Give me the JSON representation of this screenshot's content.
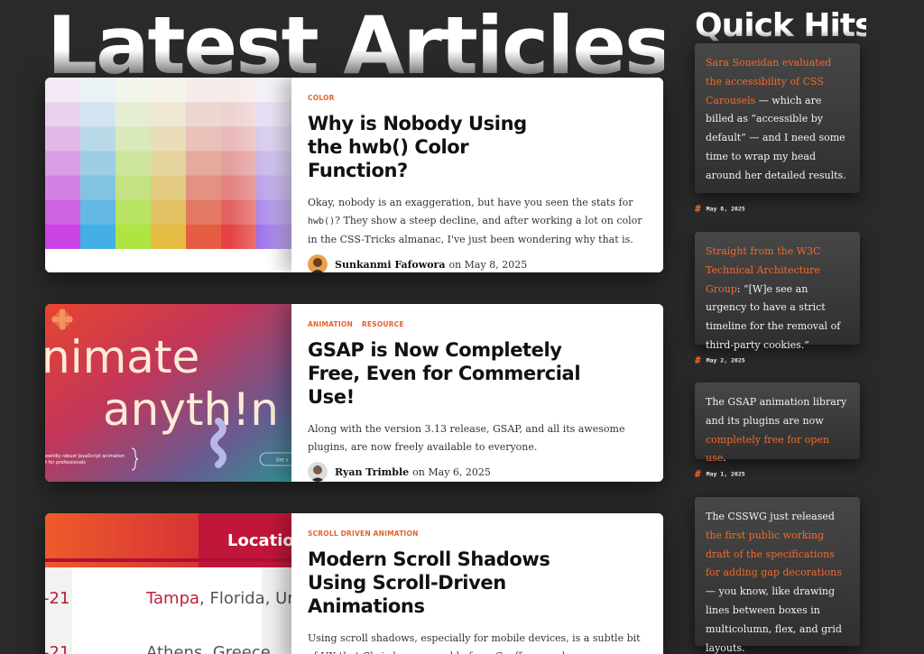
{
  "headings": {
    "latest": "Latest Articles",
    "quick_hits": "Quick Hits"
  },
  "articles": [
    {
      "tags": [
        "COLOR"
      ],
      "title": "Why is Nobody Using the hwb() Color Function?",
      "excerpt_before": "Okay, nobody is an exaggeration, but have you seen the stats for ",
      "excerpt_code": "hwb()",
      "excerpt_after": "? They show a steep decline, and after working a lot on color in the CSS-Tricks almanac, I've just been wondering why that is.",
      "author": "Sunkanmi Fafowora",
      "date": "on May 8, 2025"
    },
    {
      "tags": [
        "ANIMATION",
        "RESOURCE"
      ],
      "title": "GSAP is Now Completely Free, Even for Commercial Use!",
      "excerpt": "Along with the version 3.13 release, GSAP, and all its awesome plugins, are now freely available to everyone.",
      "author": "Ryan Trimble",
      "date": "on May 6, 2025",
      "thumb_text_1": "nimate",
      "thumb_text_2": "anyth!n",
      "thumb_small_1": "ewildly robust JavaScript animation",
      "thumb_small_2": "t for professionals",
      "thumb_button": "Get s"
    },
    {
      "tags": [
        "SCROLL DRIVEN ANIMATION"
      ],
      "title": "Modern Scroll Shadows Using Scroll-Driven Animations",
      "excerpt": "Using scroll shadows, especially for mobile devices, is a subtle bit of UX that Chris has covered before. Geoff covered a newer approach that uses",
      "thumb_header": "Locatio",
      "thumb_num_1": "-21",
      "thumb_city_1": "Tampa",
      "thumb_city_1_rest": ", Florida, Ur",
      "thumb_num_2": "-21",
      "thumb_city_2": "Athens, Greece"
    }
  ],
  "quick_hits": [
    {
      "link": "Sara Soueidan evaluated the accessibility of CSS Carousels",
      "text": " — which are billed as “accessible by default” — and I need some time to wrap my head around her detailed results.",
      "date": "May 8, 2025"
    },
    {
      "link": "Straight from the W3C Technical Architecture Group",
      "text": ": “[W]e see an urgency to have a strict timeline for the removal of third-party cookies.”",
      "date": "May 2, 2025"
    },
    {
      "text": "The GSAP animation library and its plugins are now ",
      "link": "completely free for open use",
      "text_after": ".",
      "date": "May 1, 2025"
    },
    {
      "text": "The CSSWG just released ",
      "link": "the first public working draft of the specifications for adding gap decorations",
      "text_after": " — you know, like drawing lines between boxes in multicolumn, flex, and grid layouts."
    }
  ],
  "hash_symbol": "#",
  "colors": {
    "accent": "#f26a2c",
    "background": "#2a2a2a",
    "card": "#ffffff"
  }
}
